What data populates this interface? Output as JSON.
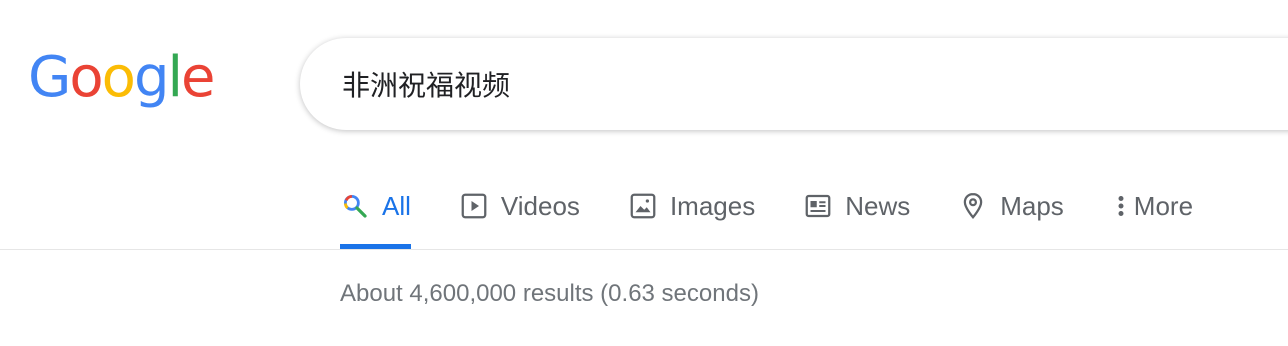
{
  "logo": {
    "letters": [
      "G",
      "o",
      "o",
      "g",
      "l",
      "e"
    ],
    "colors": [
      "#4285f4",
      "#ea4335",
      "#fbbc05",
      "#4285f4",
      "#34a853",
      "#ea4335"
    ]
  },
  "search": {
    "query": "非洲祝福视频"
  },
  "tabs": [
    {
      "label": "All",
      "icon": "search-icon",
      "active": true
    },
    {
      "label": "Videos",
      "icon": "play-icon",
      "active": false
    },
    {
      "label": "Images",
      "icon": "image-icon",
      "active": false
    },
    {
      "label": "News",
      "icon": "news-icon",
      "active": false
    },
    {
      "label": "Maps",
      "icon": "map-pin-icon",
      "active": false
    },
    {
      "label": "More",
      "icon": "more-vertical-icon",
      "active": false
    }
  ],
  "results": {
    "stats": "About 4,600,000 results (0.63 seconds)"
  },
  "colors": {
    "accent": "#1a73e8",
    "tab_text": "#5f6368",
    "stats_text": "#70757a"
  }
}
